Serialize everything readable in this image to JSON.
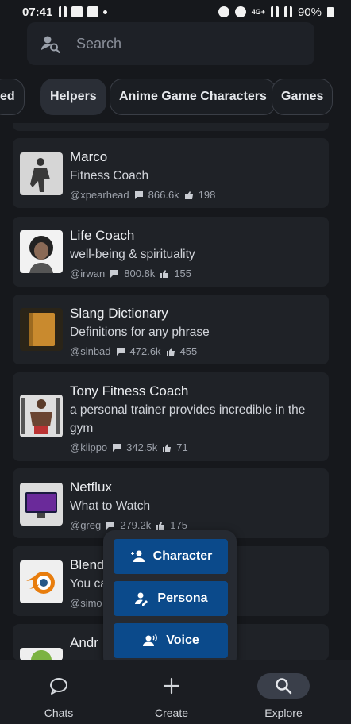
{
  "status": {
    "time": "07:41",
    "network": "4G+",
    "battery": "90%"
  },
  "search": {
    "placeholder": "Search"
  },
  "categories": [
    "ed",
    "Helpers",
    "Anime Game Characters",
    "Games"
  ],
  "bots": [
    {
      "name": "Marco",
      "desc": "Fitness Coach",
      "author": "@xpearhead",
      "chats": "866.6k",
      "likes": "198"
    },
    {
      "name": "Life Coach",
      "desc": "well-being & spirituality",
      "author": "@irwan",
      "chats": "800.8k",
      "likes": "155"
    },
    {
      "name": "Slang Dictionary",
      "desc": "Definitions for any phrase",
      "author": "@sinbad",
      "chats": "472.6k",
      "likes": "455"
    },
    {
      "name": "Tony Fitness Coach",
      "desc": "a personal trainer provides incredible in the gym",
      "author": "@klippo",
      "chats": "342.5k",
      "likes": "71"
    },
    {
      "name": "Netflux",
      "desc": "What to Watch",
      "author": "@greg",
      "chats": "279.2k",
      "likes": "175"
    },
    {
      "name": "Blend",
      "desc": "You ca",
      "author": "@simo"
    },
    {
      "name": "Andr"
    }
  ],
  "create_menu": {
    "character": "Character",
    "persona": "Persona",
    "voice": "Voice"
  },
  "nav": {
    "chats": "Chats",
    "create": "Create",
    "explore": "Explore"
  },
  "colors": {
    "accent": "#0b4a8b",
    "background": "#16181c",
    "card": "#1f2227"
  }
}
